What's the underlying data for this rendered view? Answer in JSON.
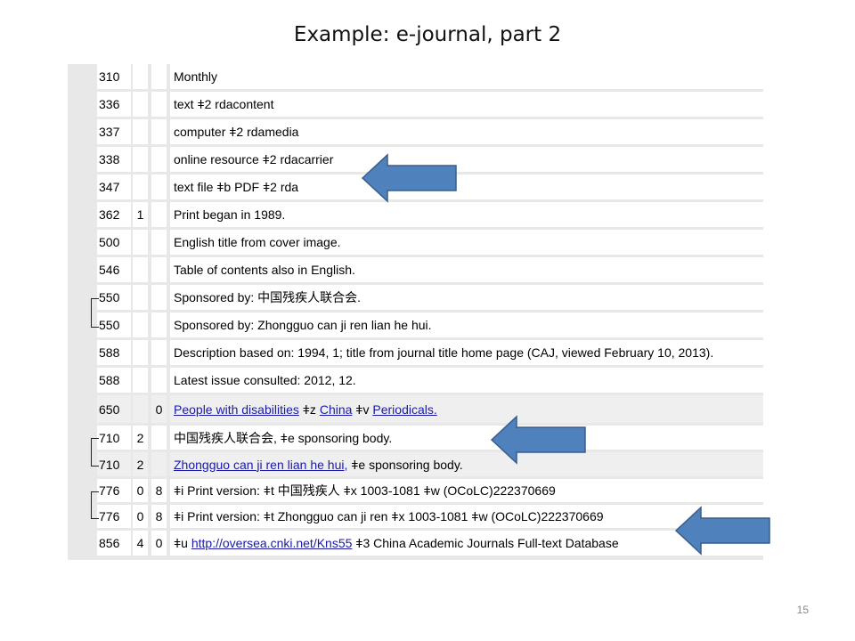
{
  "slide": {
    "title": "Example: e-journal, part 2",
    "page_number": "15"
  },
  "record": {
    "fields": [
      {
        "tag": "310",
        "ind1": "",
        "ind2": "",
        "content": [
          {
            "text": "Monthly"
          }
        ]
      },
      {
        "tag": "336",
        "ind1": "",
        "ind2": "",
        "content": [
          {
            "text": "text ǂ2 rdacontent"
          }
        ]
      },
      {
        "tag": "337",
        "ind1": "",
        "ind2": "",
        "content": [
          {
            "text": "computer ǂ2 rdamedia"
          }
        ]
      },
      {
        "tag": "338",
        "ind1": "",
        "ind2": "",
        "content": [
          {
            "text": "online resource ǂ2 rdacarrier"
          }
        ]
      },
      {
        "tag": "347",
        "ind1": "",
        "ind2": "",
        "content": [
          {
            "text": "text file ǂb PDF ǂ2 rda"
          }
        ]
      },
      {
        "tag": "362",
        "ind1": "1",
        "ind2": "",
        "content": [
          {
            "text": "Print began in 1989."
          }
        ]
      },
      {
        "tag": "500",
        "ind1": "",
        "ind2": "",
        "content": [
          {
            "text": "English title from cover image."
          }
        ]
      },
      {
        "tag": "546",
        "ind1": "",
        "ind2": "",
        "content": [
          {
            "text": "Table of contents also in English."
          }
        ]
      },
      {
        "tag": "550",
        "ind1": "",
        "ind2": "",
        "content": [
          {
            "text": "Sponsored by: 中国残疾人联合会."
          }
        ]
      },
      {
        "tag": "550",
        "ind1": "",
        "ind2": "",
        "content": [
          {
            "text": "Sponsored by: Zhongguo can ji ren lian he hui."
          }
        ]
      },
      {
        "tag": "588",
        "ind1": "",
        "ind2": "",
        "content": [
          {
            "text": "Description based on: 1994, 1; title from journal title home page (CAJ, viewed February 10, 2013)."
          }
        ]
      },
      {
        "tag": "588",
        "ind1": "",
        "ind2": "",
        "content": [
          {
            "text": "Latest issue consulted: 2012, 12."
          }
        ]
      },
      {
        "tag": "650",
        "ind1": "",
        "ind2": "0",
        "content": [
          {
            "text": "People with disabilities",
            "link": true
          },
          {
            "text": " ǂz "
          },
          {
            "text": "China",
            "link": true
          },
          {
            "text": " ǂv "
          },
          {
            "text": "Periodicals.",
            "link": true
          }
        ]
      },
      {
        "tag": "710",
        "ind1": "2",
        "ind2": "",
        "content": [
          {
            "text": "中国残疾人联合会, ǂe sponsoring body."
          }
        ]
      },
      {
        "tag": "710",
        "ind1": "2",
        "ind2": "",
        "content": [
          {
            "text": "Zhongguo can ji ren lian he hui,",
            "link": true
          },
          {
            "text": " ǂe sponsoring body."
          }
        ]
      },
      {
        "tag": "776",
        "ind1": "0",
        "ind2": "8",
        "content": [
          {
            "text": "ǂi Print version: ǂt 中国残疾人 ǂx 1003-1081 ǂw (OCoLC)222370669"
          }
        ]
      },
      {
        "tag": "776",
        "ind1": "0",
        "ind2": "8",
        "content": [
          {
            "text": "ǂi Print version: ǂt Zhongguo can ji ren ǂx 1003-1081 ǂw (OCoLC)222370669"
          }
        ]
      },
      {
        "tag": "856",
        "ind1": "4",
        "ind2": "0",
        "content": [
          {
            "text": "ǂu "
          },
          {
            "text": "http://oversea.cnki.net/Kns55",
            "link": true
          },
          {
            "text": " ǂ3 China Academic Journals Full-text Database"
          }
        ]
      }
    ]
  },
  "colors": {
    "arrow_fill": "#4f81bd",
    "arrow_stroke": "#385d8a",
    "link": "#1a1aa6",
    "row_bg_alt": "#efefef"
  },
  "annotations": {
    "arrows": [
      {
        "icon": "left-arrow-icon",
        "points_to_field_tag": "347"
      },
      {
        "icon": "left-arrow-icon",
        "points_to_field_tag": "710"
      },
      {
        "icon": "left-arrow-icon",
        "points_to_field_tag": "856"
      }
    ]
  }
}
